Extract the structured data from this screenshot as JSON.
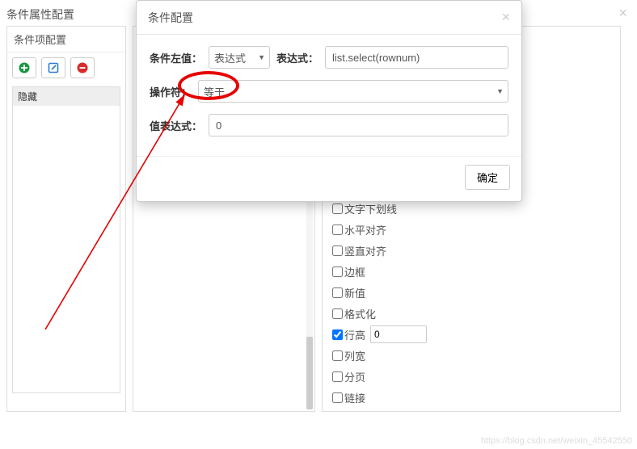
{
  "bg": {
    "title": "条件属性配置",
    "close": "×"
  },
  "leftPanel": {
    "header": "条件项配置",
    "items": [
      "隐藏"
    ]
  },
  "rightProps": {
    "items": [
      {
        "label": "文字下划线",
        "checked": false
      },
      {
        "label": "水平对齐",
        "checked": false
      },
      {
        "label": "竖直对齐",
        "checked": false
      },
      {
        "label": "边框",
        "checked": false
      },
      {
        "label": "新值",
        "checked": false
      },
      {
        "label": "格式化",
        "checked": false
      },
      {
        "label": "行高",
        "checked": true,
        "input": "0"
      },
      {
        "label": "列宽",
        "checked": false
      },
      {
        "label": "分页",
        "checked": false
      },
      {
        "label": "链接",
        "checked": false
      }
    ]
  },
  "modal": {
    "title": "条件配置",
    "close": "×",
    "row1": {
      "leftLabel": "条件左值：",
      "leftSelect": "表达式",
      "exprLabel": "表达式：",
      "exprValue": "list.select(rownum)"
    },
    "row2": {
      "opLabel": "操作符：",
      "opValue": "等于"
    },
    "row3": {
      "valLabel": "值表达式：",
      "valValue": "0"
    },
    "confirm": "确定"
  },
  "watermark": "https://blog.csdn.net/weixin_45542550"
}
